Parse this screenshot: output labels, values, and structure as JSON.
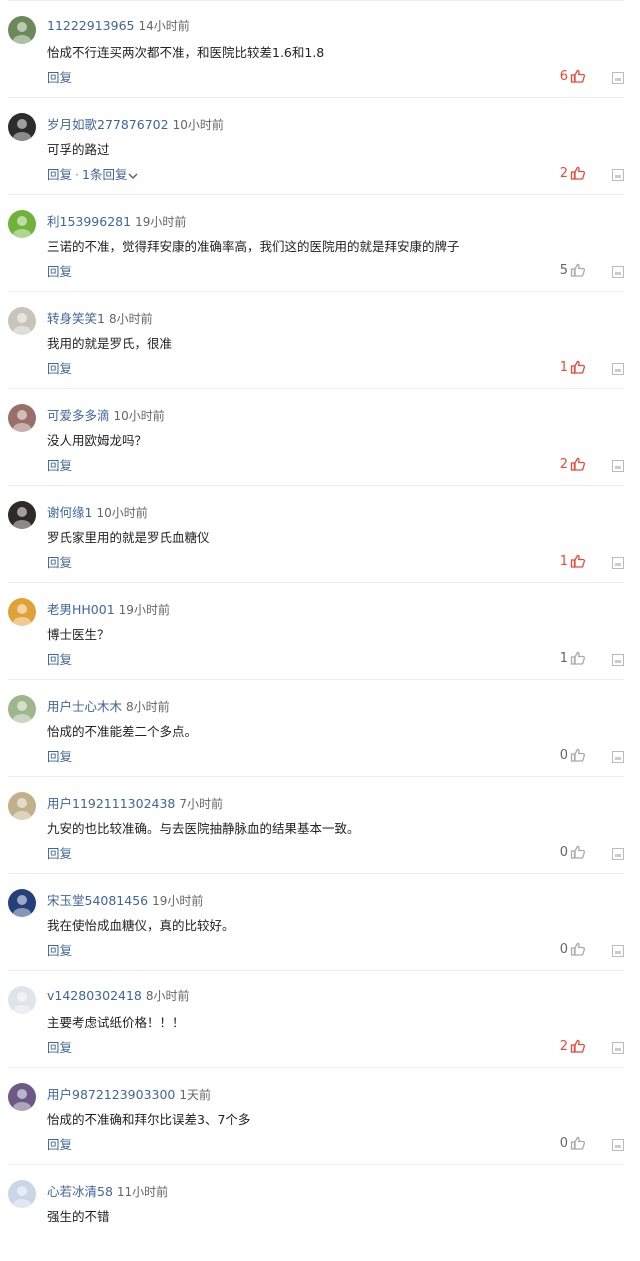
{
  "comments": [
    {
      "user": "11222913965",
      "time": "14小时前",
      "text": "怡成不行连买两次都不准，和医院比较差1.6和1.8",
      "reply": "回复",
      "sub_replies": "",
      "likes": "6",
      "liked": true,
      "avatar_color": "#6a8a5a",
      "avatar_icon": "plant-avatar"
    },
    {
      "user": "岁月如歌277876702",
      "time": "10小时前",
      "text": "可孚的路过",
      "reply": "回复",
      "sub_replies": "1条回复",
      "likes": "2",
      "liked": true,
      "avatar_color": "#2c2c2c",
      "avatar_icon": "dark-avatar"
    },
    {
      "user": "利153996281",
      "time": "19小时前",
      "text": "三诺的不准，觉得拜安康的准确率高，我们这的医院用的就是拜安康的牌子",
      "reply": "回复",
      "sub_replies": "",
      "likes": "5",
      "liked": false,
      "avatar_color": "#6fb33b",
      "avatar_icon": "leaf-avatar"
    },
    {
      "user": "转身笑笑1",
      "time": "8小时前",
      "text": "我用的就是罗氏，很准",
      "reply": "回复",
      "sub_replies": "",
      "likes": "1",
      "liked": true,
      "avatar_color": "#c9c4ba",
      "avatar_icon": "person-avatar"
    },
    {
      "user": "可爱多多滴",
      "time": "10小时前",
      "text": "没人用欧姆龙吗？",
      "reply": "回复",
      "sub_replies": "",
      "likes": "2",
      "liked": true,
      "avatar_color": "#9a6f6a",
      "avatar_icon": "group-avatar"
    },
    {
      "user": "谢何缘1",
      "time": "10小时前",
      "text": "罗氏家里用的就是罗氏血糖仪",
      "reply": "回复",
      "sub_replies": "",
      "likes": "1",
      "liked": true,
      "avatar_color": "#2f2a26",
      "avatar_icon": "man-avatar"
    },
    {
      "user": "老男HH001",
      "time": "19小时前",
      "text": "博士医生？",
      "reply": "回复",
      "sub_replies": "",
      "likes": "1",
      "liked": false,
      "avatar_color": "#e0a238",
      "avatar_icon": "cartoon-avatar"
    },
    {
      "user": "用户士心木木",
      "time": "8小时前",
      "text": "怡成的不准能差二个多点。",
      "reply": "回复",
      "sub_replies": "",
      "likes": "0",
      "liked": false,
      "avatar_color": "#9fb58c",
      "avatar_icon": "default-avatar"
    },
    {
      "user": "用户1192111302438",
      "time": "7小时前",
      "text": "九安的也比较准确。与去医院抽静脉血的结果基本一致。",
      "reply": "回复",
      "sub_replies": "",
      "likes": "0",
      "liked": false,
      "avatar_color": "#c2b08a",
      "avatar_icon": "default-avatar"
    },
    {
      "user": "宋玉堂54081456",
      "time": "19小时前",
      "text": "我在使怡成血糖仪，真的比较好。",
      "reply": "回复",
      "sub_replies": "",
      "likes": "0",
      "liked": false,
      "avatar_color": "#23407a",
      "avatar_icon": "emblem-avatar"
    },
    {
      "user": "v14280302418",
      "time": "8小时前",
      "text": "主要考虑试纸价格！！！",
      "reply": "回复",
      "sub_replies": "",
      "likes": "2",
      "liked": true,
      "avatar_color": "#dfe3ea",
      "avatar_icon": "cloud-avatar"
    },
    {
      "user": "用户9872123903300",
      "time": "1天前",
      "text": "怡成的不准确和拜尔比误差3、7个多",
      "reply": "回复",
      "sub_replies": "",
      "likes": "0",
      "liked": false,
      "avatar_color": "#6c5a86",
      "avatar_icon": "flag-avatar"
    },
    {
      "user": "心若冰清58",
      "time": "11小时前",
      "text": "强生的不错",
      "reply": "回复",
      "sub_replies": "",
      "likes": "",
      "liked": false,
      "avatar_color": "#c9d6e6",
      "avatar_icon": "cloud-avatar"
    }
  ]
}
